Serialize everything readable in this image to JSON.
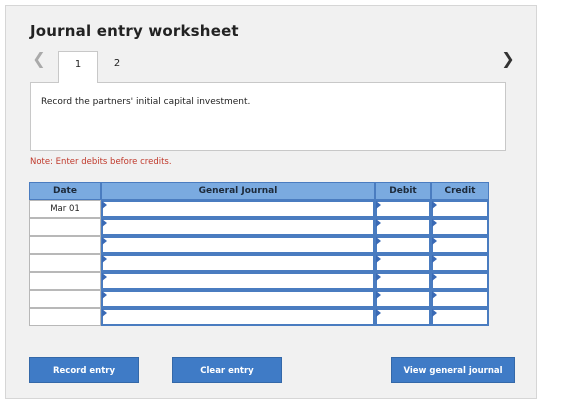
{
  "worksheet": {
    "title": "Journal entry worksheet",
    "tabs": [
      {
        "label": "1",
        "active": true
      },
      {
        "label": "2",
        "active": false
      }
    ],
    "prompt": "Record the partners' initial capital investment.",
    "note": "Note: Enter debits before credits."
  },
  "table": {
    "headers": {
      "date": "Date",
      "general_journal": "General Journal",
      "debit": "Debit",
      "credit": "Credit"
    },
    "rows": [
      {
        "date": "Mar 01",
        "account": "",
        "debit": "",
        "credit": ""
      },
      {
        "date": "",
        "account": "",
        "debit": "",
        "credit": ""
      },
      {
        "date": "",
        "account": "",
        "debit": "",
        "credit": ""
      },
      {
        "date": "",
        "account": "",
        "debit": "",
        "credit": ""
      },
      {
        "date": "",
        "account": "",
        "debit": "",
        "credit": ""
      },
      {
        "date": "",
        "account": "",
        "debit": "",
        "credit": ""
      },
      {
        "date": "",
        "account": "",
        "debit": "",
        "credit": ""
      }
    ]
  },
  "buttons": {
    "record": "Record entry",
    "clear": "Clear entry",
    "view": "View general journal"
  },
  "icons": {
    "prev": "chevron-left-icon",
    "next": "chevron-right-icon"
  },
  "colors": {
    "header_bg": "#7aaae0",
    "button_bg": "#3f7bc6",
    "note_text": "#c0392b",
    "input_border": "#4a7cc0"
  }
}
